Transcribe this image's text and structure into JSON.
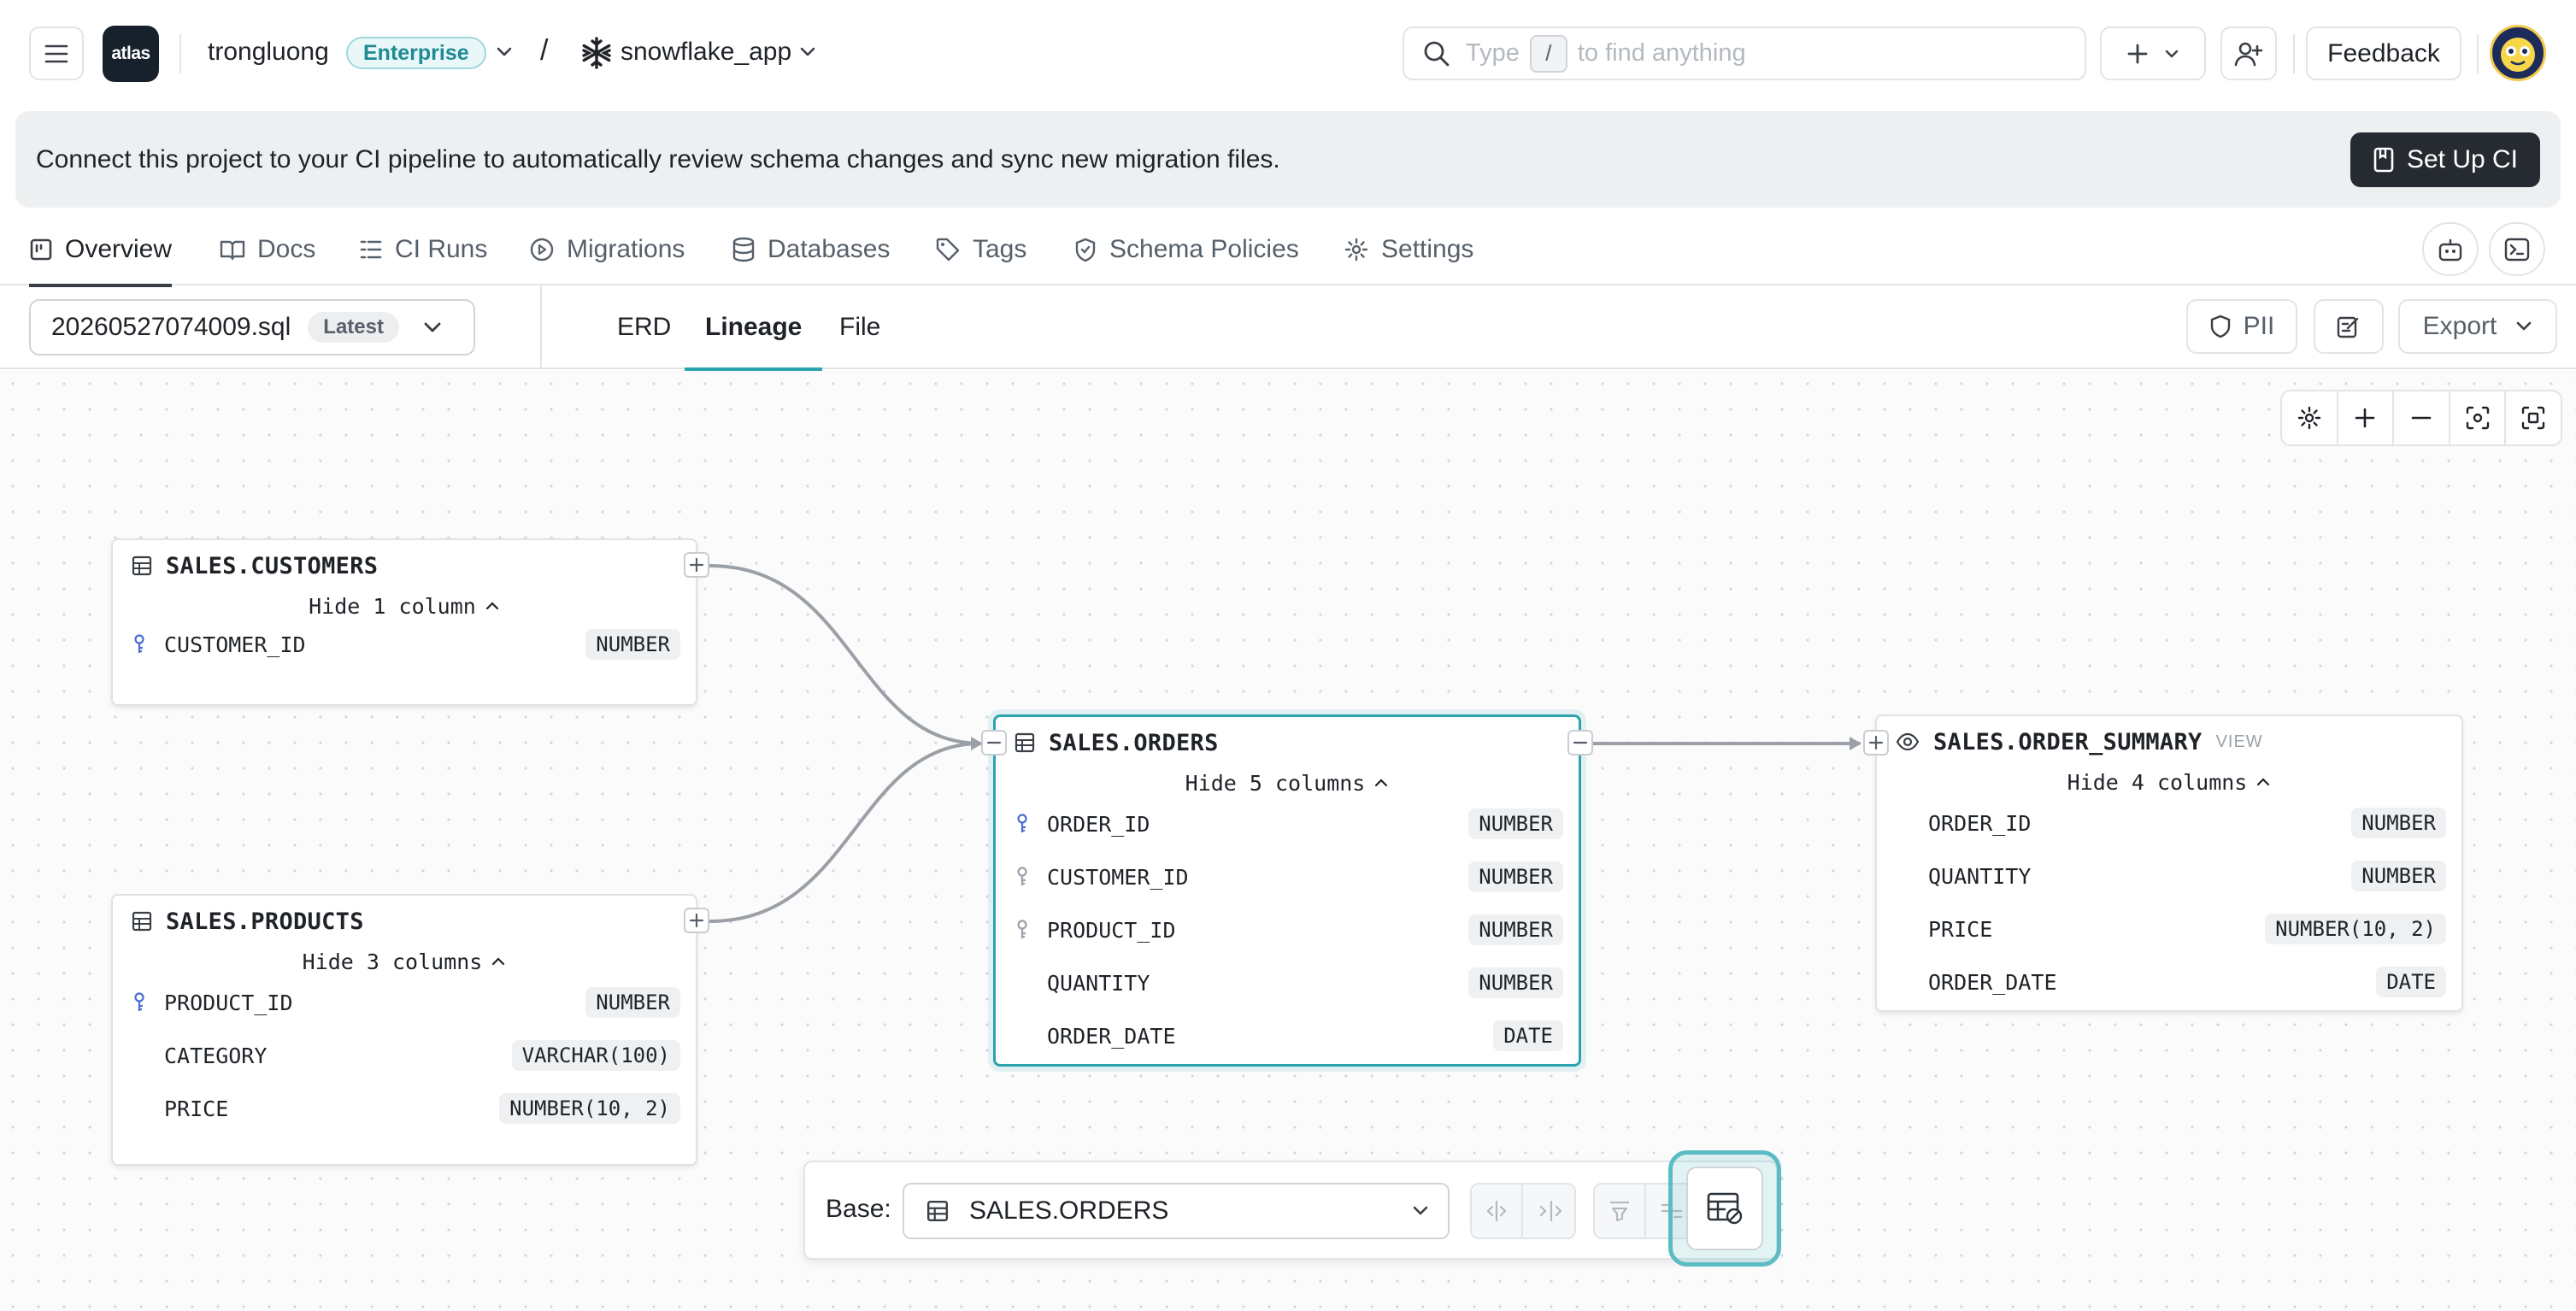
{
  "topbar": {
    "logo_text": "atlas",
    "org_name": "trongluong",
    "plan_badge": "Enterprise",
    "separator": "/",
    "project_name": "snowflake_app",
    "search_placeholder_pre": "Type",
    "search_shortcut": "/",
    "search_placeholder_post": "to find anything",
    "feedback_label": "Feedback"
  },
  "banner": {
    "message": "Connect this project to your CI pipeline to automatically review schema changes and sync new migration files.",
    "button_label": "Set Up CI"
  },
  "nav": {
    "tabs": [
      {
        "label": "Overview",
        "icon": "overview-icon",
        "active": true
      },
      {
        "label": "Docs",
        "icon": "docs-icon"
      },
      {
        "label": "CI Runs",
        "icon": "ci-runs-icon"
      },
      {
        "label": "Migrations",
        "icon": "migrations-icon"
      },
      {
        "label": "Databases",
        "icon": "database-icon"
      },
      {
        "label": "Tags",
        "icon": "tag-icon"
      },
      {
        "label": "Schema Policies",
        "icon": "shield-icon"
      },
      {
        "label": "Settings",
        "icon": "gear-icon"
      }
    ]
  },
  "subbar": {
    "file_name": "20260527074009.sql",
    "file_badge": "Latest",
    "view_tabs": [
      "ERD",
      "Lineage",
      "File"
    ],
    "active_view": "Lineage",
    "pii_label": "PII",
    "export_label": "Export"
  },
  "nodes": {
    "customers": {
      "title": "SALES.CUSTOMERS",
      "hide_label": "Hide 1 column",
      "columns": [
        {
          "name": "CUSTOMER_ID",
          "type": "NUMBER",
          "key": "primary"
        }
      ]
    },
    "products": {
      "title": "SALES.PRODUCTS",
      "hide_label": "Hide 3 columns",
      "columns": [
        {
          "name": "PRODUCT_ID",
          "type": "NUMBER",
          "key": "primary"
        },
        {
          "name": "CATEGORY",
          "type": "VARCHAR(100)"
        },
        {
          "name": "PRICE",
          "type": "NUMBER(10, 2)"
        }
      ]
    },
    "orders": {
      "title": "SALES.ORDERS",
      "hide_label": "Hide 5 columns",
      "columns": [
        {
          "name": "ORDER_ID",
          "type": "NUMBER",
          "key": "primary"
        },
        {
          "name": "CUSTOMER_ID",
          "type": "NUMBER",
          "key": "foreign"
        },
        {
          "name": "PRODUCT_ID",
          "type": "NUMBER",
          "key": "foreign"
        },
        {
          "name": "QUANTITY",
          "type": "NUMBER"
        },
        {
          "name": "ORDER_DATE",
          "type": "DATE"
        }
      ]
    },
    "order_summary": {
      "title": "SALES.ORDER_SUMMARY",
      "kind": "VIEW",
      "hide_label": "Hide 4 columns",
      "columns": [
        {
          "name": "ORDER_ID",
          "type": "NUMBER"
        },
        {
          "name": "QUANTITY",
          "type": "NUMBER"
        },
        {
          "name": "PRICE",
          "type": "NUMBER(10, 2)"
        },
        {
          "name": "ORDER_DATE",
          "type": "DATE"
        }
      ]
    }
  },
  "basebar": {
    "label": "Base:",
    "selected": "SALES.ORDERS"
  },
  "colors": {
    "accent": "#2ba3ad",
    "primary_key": "#4a6fd1",
    "foreign_key": "#9aa1a9"
  }
}
